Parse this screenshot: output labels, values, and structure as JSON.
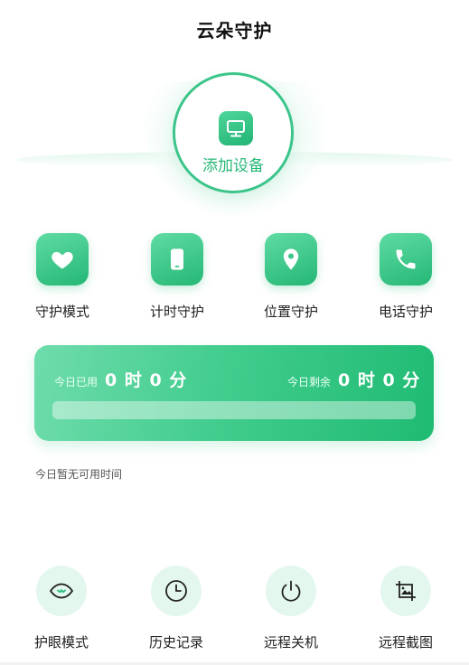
{
  "header": {
    "title": "云朵守护"
  },
  "add_device": {
    "label": "添加设备",
    "icon": "monitor-icon"
  },
  "features": [
    {
      "label": "守护模式",
      "icon": "heart-icon"
    },
    {
      "label": "计时守护",
      "icon": "phone-icon"
    },
    {
      "label": "位置守护",
      "icon": "location-pin-icon"
    },
    {
      "label": "电话守护",
      "icon": "phone-call-icon"
    }
  ],
  "usage": {
    "used_label": "今日已用",
    "used_value": "0 时 0 分",
    "remaining_label": "今日剩余",
    "remaining_value": "0 时 0 分",
    "progress": 0
  },
  "note": "今日暂无可用时间",
  "tools": [
    {
      "label": "护眼模式",
      "icon": "eye-icon"
    },
    {
      "label": "历史记录",
      "icon": "clock-icon"
    },
    {
      "label": "远程关机",
      "icon": "power-icon"
    },
    {
      "label": "远程截图",
      "icon": "crop-image-icon"
    }
  ],
  "colors": {
    "accent": "#27b877",
    "tile_light": "#5fdba4",
    "tile_dark": "#25b775",
    "tool_bg": "#e3f7ee"
  }
}
